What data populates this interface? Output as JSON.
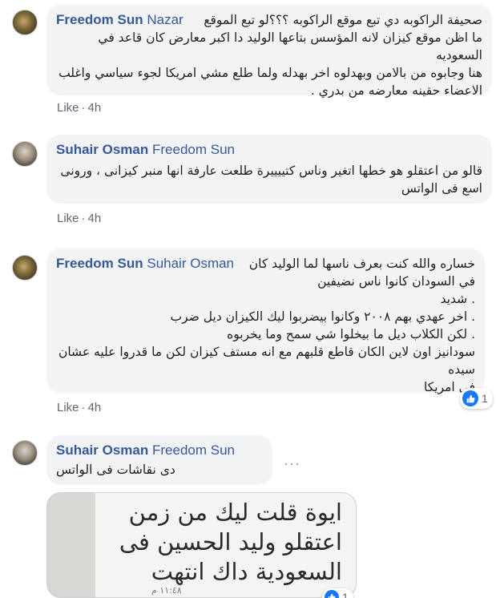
{
  "comments": [
    {
      "author": "Freedom Sun",
      "mention": "Nazar",
      "text": "صحيفة الراكوبه دي تبع موقع الراكوبه ؟؟؟لو تبع الموقع\nما اظن موقع كيزان لانه المؤسس بتاعها الوليد دا اكبر معارض كان قاعد في السعوديه\nهنا وجابوه من بالامن وبهدلوه اخر بهدله ولما طلع مشي امريكا لجوء سياسي واغلب\nالاعضاء حقينه معارضه من بدري .",
      "like_label": "Like",
      "time": "4h"
    },
    {
      "author": "Suhair Osman",
      "mention": "Freedom Sun",
      "text": "قالو من اعتقلو هو خطها اتغير وناس كتييييرة طلعت عارفة انها منبر كيزانى ، ورونى\nاسع فى الواتس",
      "like_label": "Like",
      "time": "4h"
    },
    {
      "author": "Freedom Sun",
      "mention": "Suhair Osman",
      "text": "خساره والله كنت بعرف ناسها لما الوليد كان\nفي السودان كانوا ناس نضيفين\n. شديد\n. اخر عهدي بهم ٢٠٠٨ وكانوا بيضربوا ليك الكيزان ديل ضرب\n. لكن الكلاب ديل ما بيخلوا شي سمح وما يخربوه\nسودانيز اون لاين الكان قاطع قلبهم مع انه مستف كيزان لكن ما قدروا عليه عشان سيده\nفي امريكا",
      "like_label": "Like",
      "time": "4h",
      "reaction_count": "1"
    },
    {
      "author": "Suhair Osman",
      "mention": "Freedom Sun",
      "text": "دى نقاشات فى الواتس",
      "image_text": "ايوة قلت ليك من زمن\nاعتقلو وليد الحسين فى\nالسعودية داك انتهت",
      "image_time": "١١:٤٨ م",
      "reaction_count": "1"
    }
  ],
  "colors": {
    "author": "#385898",
    "bubble": "#f2f3f5",
    "meta": "#606770",
    "like_blue": "#1877f2"
  },
  "icons": [
    "avatar",
    "like-reaction-icon",
    "more-options-icon"
  ],
  "more_options_glyph": "···"
}
